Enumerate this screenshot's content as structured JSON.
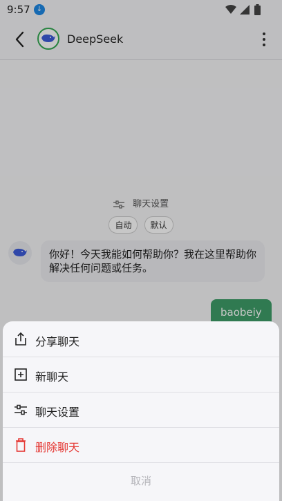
{
  "status_bar": {
    "time": "9:57"
  },
  "header": {
    "title": "DeepSeek"
  },
  "chat": {
    "settings_label": "聊天设置",
    "chips": [
      "自动",
      "默认"
    ],
    "bot_message": "你好！今天我能如何帮助你？我在这里帮助你解决任何问题或任务。",
    "user_message": "baobeiy"
  },
  "action_sheet": {
    "share": "分享聊天",
    "new_chat": "新聊天",
    "settings": "聊天设置",
    "delete": "删除聊天",
    "cancel": "取消"
  },
  "colors": {
    "accent_green": "#3e9d68",
    "danger": "#e53935",
    "brand_blue": "#3d5bd9"
  },
  "icons": [
    "download-icon",
    "wifi-icon",
    "signal-icon",
    "battery-icon",
    "back-icon",
    "deepseek-logo-icon",
    "more-icon",
    "share-icon",
    "new-chat-icon",
    "settings-sliders-icon",
    "trash-icon"
  ]
}
